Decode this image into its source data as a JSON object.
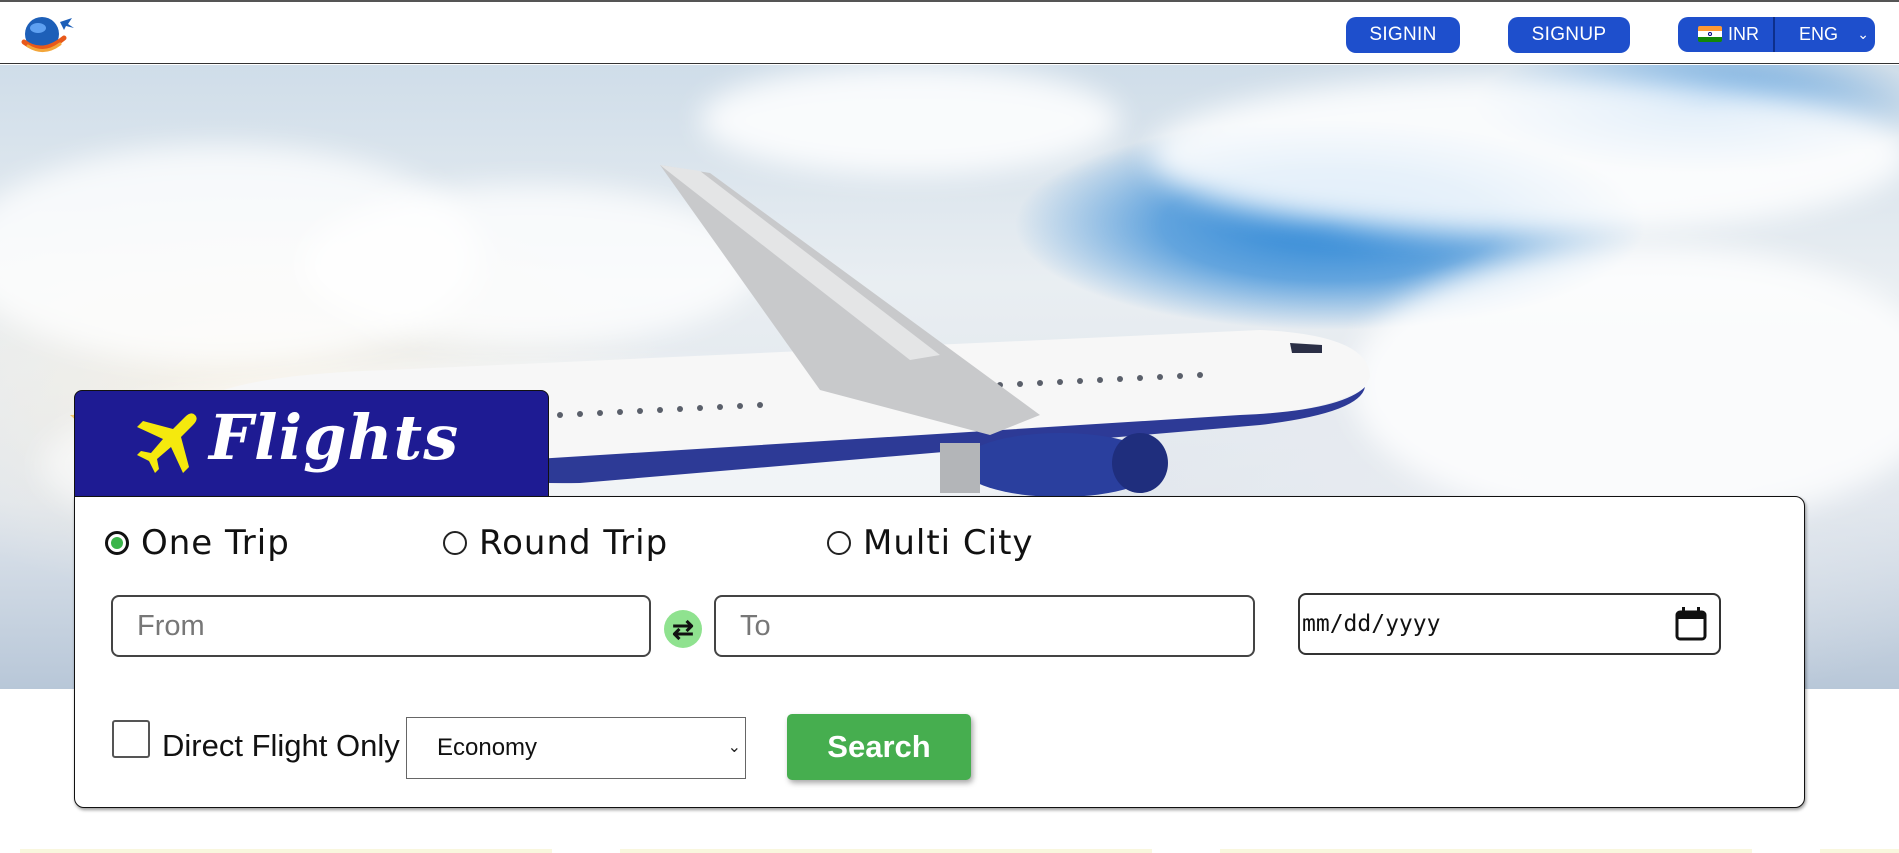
{
  "header": {
    "logo_icon": "globe-airplane-logo-icon",
    "signin_label": "SIGNIN",
    "signup_label": "SIGNUP",
    "currency": {
      "flag_icon": "india-flag-icon",
      "label": "INR"
    },
    "language": {
      "label": "ENG",
      "chevron_icon": "chevron-down-icon"
    }
  },
  "hero": {
    "image": "airplane-in-sky-photo"
  },
  "tab": {
    "icon": "airplane-icon",
    "title": "Flights",
    "colors": {
      "background": "#1e1b93",
      "icon": "#f5e90d"
    }
  },
  "search": {
    "trip_types": [
      {
        "label": "One Trip",
        "selected": true
      },
      {
        "label": "Round Trip",
        "selected": false
      },
      {
        "label": "Multi City",
        "selected": false
      }
    ],
    "from_placeholder": "From",
    "swap_icon": "swap-arrows-icon",
    "to_placeholder": "To",
    "date_placeholder": "mm/dd/yyyy",
    "calendar_icon": "calendar-icon",
    "direct_flight_label": "Direct Flight Only",
    "direct_flight_checked": false,
    "cabin_class": "Economy",
    "search_label": "Search",
    "colors": {
      "accent_green": "#46ae4f",
      "nav_blue": "#1e4fcc"
    }
  }
}
